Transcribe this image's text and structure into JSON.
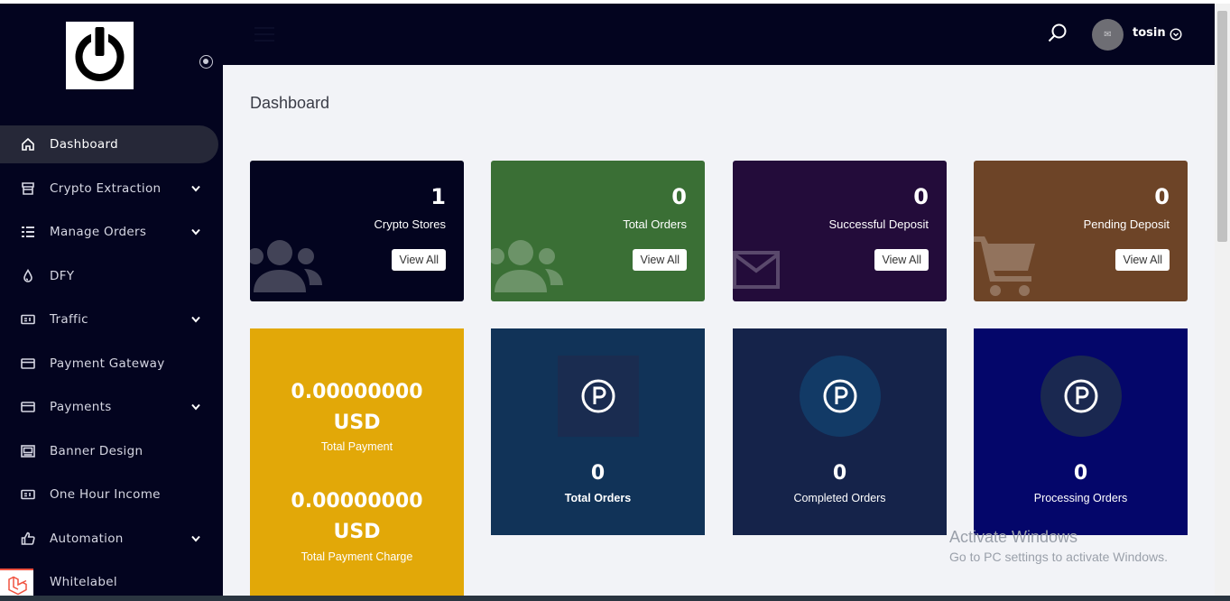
{
  "header": {
    "username": "tosin",
    "avatar_alt": "✉"
  },
  "sidebar": {
    "items": [
      {
        "label": "Dashboard",
        "icon": "home-icon",
        "caret": false,
        "active": true
      },
      {
        "label": "Crypto Extraction",
        "icon": "store-icon",
        "caret": true
      },
      {
        "label": "Manage Orders",
        "icon": "list-icon",
        "caret": true
      },
      {
        "label": "DFY",
        "icon": "drop-icon",
        "caret": false
      },
      {
        "label": "Traffic",
        "icon": "card-icon",
        "caret": true
      },
      {
        "label": "Payment Gateway",
        "icon": "credit-card-icon",
        "caret": false
      },
      {
        "label": "Payments",
        "icon": "credit-card-icon",
        "caret": true
      },
      {
        "label": "Banner Design",
        "icon": "banner-icon",
        "caret": false
      },
      {
        "label": "One Hour Income",
        "icon": "card-icon",
        "caret": false
      },
      {
        "label": "Automation",
        "icon": "thumbs-up-icon",
        "caret": true
      },
      {
        "label": "Whitelabel",
        "icon": "whitelabel-icon",
        "caret": false
      }
    ]
  },
  "main": {
    "title": "Dashboard",
    "cards": [
      {
        "value": "1",
        "label": "Crypto Stores",
        "button": "View All",
        "color": "#03041f",
        "icon": "users-icon"
      },
      {
        "value": "0",
        "label": "Total Orders",
        "button": "View All",
        "color": "#3a6f35",
        "icon": "users-icon"
      },
      {
        "value": "0",
        "label": "Successful Deposit",
        "button": "View All",
        "color": "#230c3a",
        "icon": "envelope-icon"
      },
      {
        "value": "0",
        "label": "Pending Deposit",
        "button": "View All",
        "color": "#6d4427",
        "icon": "cart-icon"
      }
    ],
    "payments": {
      "total_payment": "0.00000000 USD",
      "total_payment_label": "Total Payment",
      "total_charge": "0.00000000 USD",
      "total_charge_label": "Total Payment Charge",
      "color": "#e2a808"
    },
    "stats": [
      {
        "value": "0",
        "label": "Total Orders",
        "color": "#113358",
        "circle_color": "#1a2c50",
        "shape": "square"
      },
      {
        "value": "0",
        "label": "Completed Orders",
        "color": "#15234a",
        "circle_color": "#123a66",
        "shape": "circle"
      },
      {
        "value": "0",
        "label": "Processing Orders",
        "color": "#04066a",
        "circle_color": "#1a2850",
        "shape": "circle"
      }
    ]
  },
  "watermark": {
    "line1": "Activate Windows",
    "line2": "Go to PC settings to activate Windows."
  }
}
